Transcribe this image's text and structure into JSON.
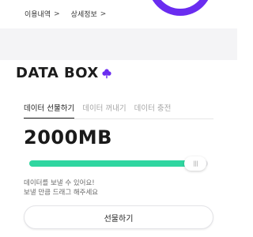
{
  "header": {
    "links": [
      {
        "label": "이용내역",
        "chevron": ">"
      },
      {
        "label": "상세정보",
        "chevron": ">"
      }
    ],
    "decor_color": "#6a2cf0"
  },
  "brand": {
    "text": "DATA BOX",
    "icon": "clover-icon",
    "icon_color": "#6a2cf0"
  },
  "tabs": [
    {
      "label": "데이터 선물하기",
      "active": true
    },
    {
      "label": "데이터 꺼내기",
      "active": false
    },
    {
      "label": "데이터 충전",
      "active": false
    }
  ],
  "amount": "2000MB",
  "slider": {
    "value_fraction": 0.93,
    "handle_glyph": "|||",
    "fill_color": "#2fd6a0"
  },
  "hint": {
    "line1": "데이터를 보낼 수 있어요!",
    "line2": "보낼 만큼 드래그 해주세요"
  },
  "button": {
    "label": "선물하기"
  }
}
